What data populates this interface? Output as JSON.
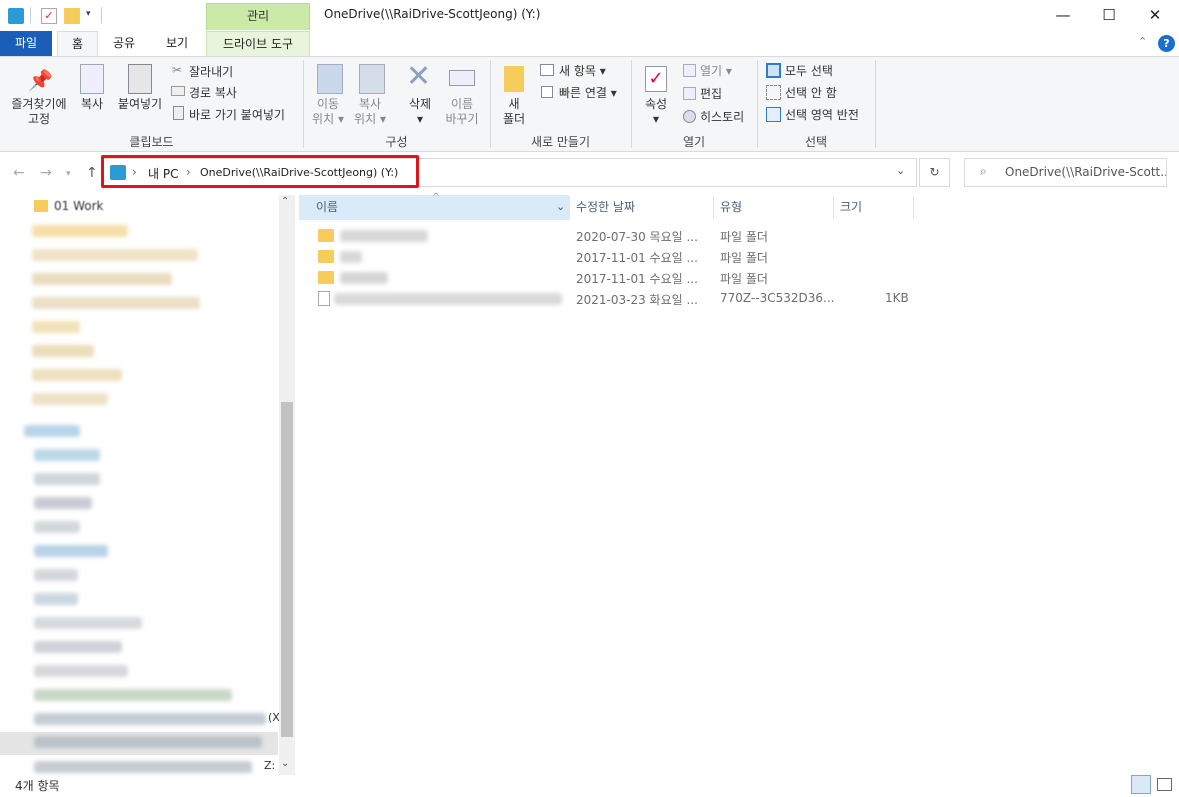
{
  "window": {
    "title": "OneDrive(\\\\RaiDrive-ScottJeong) (Y:)",
    "context_tab": "관리",
    "controls": {
      "minimize": "—",
      "maximize": "☐",
      "close": "✕"
    }
  },
  "tabs": {
    "file": "파일",
    "home": "홈",
    "share": "공유",
    "view": "보기",
    "drive_tools": "드라이브 도구"
  },
  "ribbon": {
    "clipboard": {
      "pin_line1": "즐겨찾기에",
      "pin_line2": "고정",
      "copy": "복사",
      "paste": "붙여넣기",
      "cut": "잘라내기",
      "copy_path": "경로 복사",
      "paste_shortcut": "바로 가기 붙여넣기",
      "label": "클립보드"
    },
    "organize": {
      "move_line1": "이동",
      "move_line2": "위치",
      "copyto_line1": "복사",
      "copyto_line2": "위치",
      "delete": "삭제",
      "rename_line1": "이름",
      "rename_line2": "바꾸기",
      "label": "구성"
    },
    "new": {
      "new_folder_line1": "새",
      "new_folder_line2": "폴더",
      "new_item": "새 항목",
      "easy_access": "빠른 연결",
      "label": "새로 만들기"
    },
    "open": {
      "properties": "속성",
      "open": "열기",
      "edit": "편집",
      "history": "히스토리",
      "label": "열기"
    },
    "select": {
      "select_all": "모두 선택",
      "select_none": "선택 안 함",
      "invert": "선택 영역 반전",
      "label": "선택"
    }
  },
  "address": {
    "crumb1": "내 PC",
    "crumb2": "OneDrive(\\\\RaiDrive-ScottJeong) (Y:)",
    "search_placeholder": "OneDrive(\\\\RaiDrive-Scott..."
  },
  "navpane": {
    "first_item": "01 Work"
  },
  "columns": {
    "name": "이름",
    "modified": "수정한 날짜",
    "type": "유형",
    "size": "크기"
  },
  "files": [
    {
      "modified": "2020-07-30 목요일 ...",
      "type": "파일 폴더",
      "size": ""
    },
    {
      "modified": "2017-11-01 수요일 ...",
      "type": "파일 폴더",
      "size": ""
    },
    {
      "modified": "2017-11-01 수요일 ...",
      "type": "파일 폴더",
      "size": ""
    },
    {
      "modified": "2021-03-23 화요일 ...",
      "type": "770Z--3C532D36...",
      "size": "1KB"
    }
  ],
  "status": {
    "item_count": "4개 항목"
  }
}
